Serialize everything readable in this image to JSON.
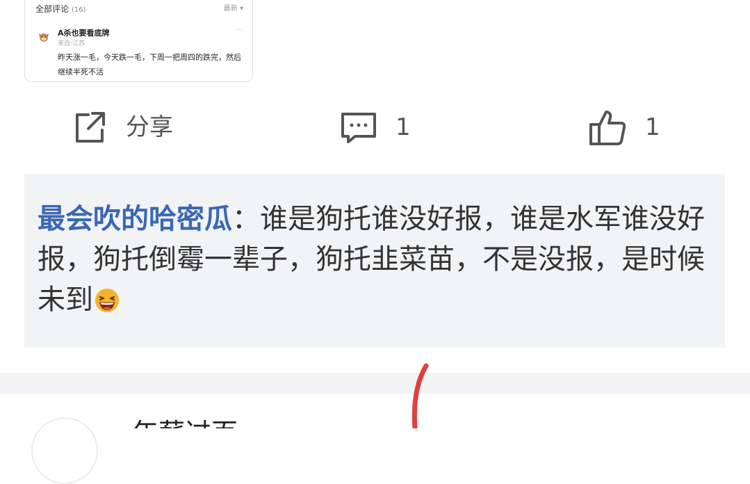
{
  "card": {
    "title": "全部评论",
    "count": "(16)",
    "sort": "最新 ▾",
    "user": "A杀也要看底牌",
    "location": "来自:江苏",
    "more": "···",
    "text": "昨天涨一毛，今天跌一毛，下周一把周四的跌完，然后继续半死不活"
  },
  "actions": {
    "share_label": "分享",
    "comment_count": "1",
    "like_count": "1"
  },
  "reply": {
    "user": "最会吹的哈密瓜",
    "separator": "：",
    "text": "谁是狗托谁没好报，谁是水军谁没好报，狗托倒霉一辈子，狗托韭菜苗，不是没报，是时候未到",
    "emoji": "laughing-emoji"
  },
  "next_post": {
    "name": "年薪过百"
  },
  "colors": {
    "username_blue": "#3a68b4",
    "reply_bg": "#f2f3f5",
    "icon_gray": "#555555",
    "annotation_red": "#e04040"
  }
}
